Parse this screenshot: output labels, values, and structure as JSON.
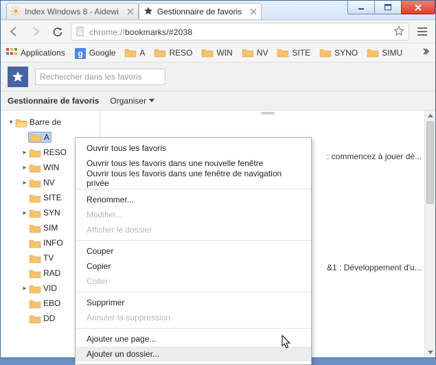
{
  "tabs": [
    {
      "label": "Index Windows 8 - Aidewi",
      "icon": "sun"
    },
    {
      "label": "Gestionnaire de favoris",
      "icon": "star"
    }
  ],
  "url_prefix": "chrome://",
  "url_path": "bookmarks/#2038",
  "bookmarks_bar": {
    "apps_label": "Applications",
    "items": [
      {
        "label": "Google",
        "icon": "g"
      },
      {
        "label": "A"
      },
      {
        "label": "RESO"
      },
      {
        "label": "WIN"
      },
      {
        "label": "NV"
      },
      {
        "label": "SITE"
      },
      {
        "label": "SYNO"
      },
      {
        "label": "SIMU"
      }
    ]
  },
  "page": {
    "search_placeholder": "Rechercher dans les favoris",
    "title": "Gestionnaire de favoris",
    "organize_label": "Organiser"
  },
  "tree": {
    "root": "Barre de",
    "items": [
      {
        "label": "A",
        "expandable": false,
        "selected": true
      },
      {
        "label": "RESO",
        "expandable": true
      },
      {
        "label": "WIN",
        "expandable": true
      },
      {
        "label": "NV ",
        "expandable": true
      },
      {
        "label": "SITE",
        "expandable": false
      },
      {
        "label": "SYN",
        "expandable": true
      },
      {
        "label": "SIM",
        "expandable": false
      },
      {
        "label": "INFO",
        "expandable": false
      },
      {
        "label": "TV ",
        "expandable": false
      },
      {
        "label": "RAD",
        "expandable": false
      },
      {
        "label": "VID",
        "expandable": true
      },
      {
        "label": "EBO",
        "expandable": false
      },
      {
        "label": "DD ",
        "expandable": false
      }
    ]
  },
  "right_snippets": [
    ": commencez à jouer dè...",
    "&1 : Développement d'u..."
  ],
  "context_menu": [
    {
      "label": "Ouvrir tous les favoris",
      "enabled": true
    },
    {
      "label": "Ouvrir tous les favoris dans une nouvelle fenêtre",
      "enabled": true
    },
    {
      "label": "Ouvrir tous les favoris dans une fenêtre de navigation privée",
      "enabled": true
    },
    {
      "sep": true
    },
    {
      "label": "Renommer...",
      "enabled": true
    },
    {
      "label": "Modifier...",
      "enabled": false
    },
    {
      "label": "Afficher le dossier",
      "enabled": false
    },
    {
      "sep": true
    },
    {
      "label": "Couper",
      "enabled": true
    },
    {
      "label": "Copier",
      "enabled": true
    },
    {
      "label": "Coller",
      "enabled": false
    },
    {
      "sep": true
    },
    {
      "label": "Supprimer",
      "enabled": true
    },
    {
      "label": "Annuler la suppression",
      "enabled": false
    },
    {
      "sep": true
    },
    {
      "label": "Ajouter une page...",
      "enabled": true
    },
    {
      "label": "Ajouter un dossier...",
      "enabled": true,
      "hover": true
    }
  ]
}
